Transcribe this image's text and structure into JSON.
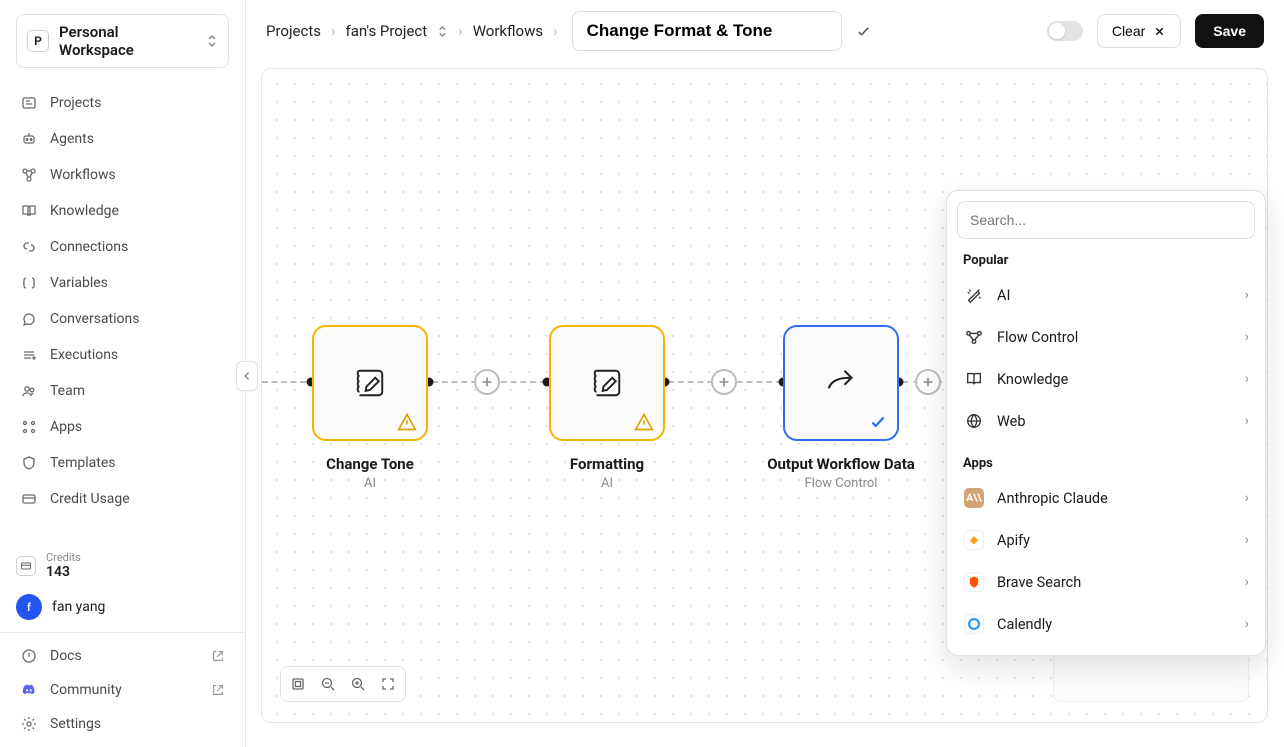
{
  "workspace": {
    "initial": "P",
    "name": "Personal Workspace"
  },
  "sidebar": {
    "items": [
      {
        "label": "Projects"
      },
      {
        "label": "Agents"
      },
      {
        "label": "Workflows"
      },
      {
        "label": "Knowledge"
      },
      {
        "label": "Connections"
      },
      {
        "label": "Variables"
      },
      {
        "label": "Conversations"
      },
      {
        "label": "Executions"
      },
      {
        "label": "Team"
      },
      {
        "label": "Apps"
      },
      {
        "label": "Templates"
      },
      {
        "label": "Credit Usage"
      }
    ],
    "credits_label": "Credits",
    "credits_value": "143",
    "user_initial": "f",
    "user_name": "fan yang",
    "bottom": [
      {
        "label": "Docs"
      },
      {
        "label": "Community"
      },
      {
        "label": "Settings"
      }
    ]
  },
  "breadcrumb": {
    "projects": "Projects",
    "project": "fan's Project",
    "workflows": "Workflows"
  },
  "title": "Change Format & Tone",
  "actions": {
    "clear": "Clear",
    "save": "Save"
  },
  "nodes": {
    "n1": {
      "title": "Change Tone",
      "subtitle": "AI"
    },
    "n2": {
      "title": "Formatting",
      "subtitle": "AI"
    },
    "n3": {
      "title": "Output Workflow Data",
      "subtitle": "Flow Control"
    }
  },
  "popover": {
    "search_placeholder": "Search...",
    "section_popular": "Popular",
    "popular": [
      {
        "label": "AI"
      },
      {
        "label": "Flow Control"
      },
      {
        "label": "Knowledge"
      },
      {
        "label": "Web"
      }
    ],
    "section_apps": "Apps",
    "apps": [
      {
        "label": "Anthropic Claude"
      },
      {
        "label": "Apify"
      },
      {
        "label": "Brave Search"
      },
      {
        "label": "Calendly"
      }
    ]
  }
}
